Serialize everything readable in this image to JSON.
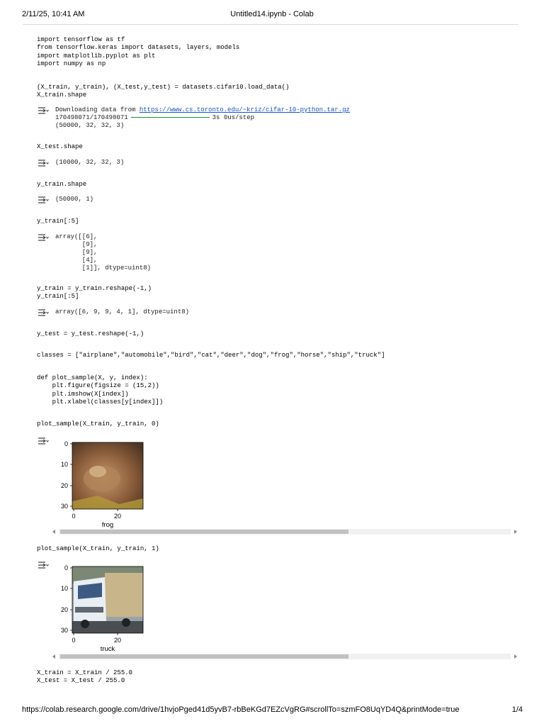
{
  "header": {
    "datetime": "2/11/25, 10:41 AM",
    "title": "Untitled14.ipynb - Colab"
  },
  "footer": {
    "url": "https://colab.research.google.com/drive/1hvjoPged41d5yvB7-rbBeKGd7EZcVgRG#scrollTo=szmFO8UqYD4Q&printMode=true",
    "page": "1/4"
  },
  "cells": {
    "c1": "import tensorflow as tf\nfrom tensorflow.keras import datasets, layers, models\nimport matplotlib.pyplot as plt\nimport numpy as np",
    "c2": "(X_train, y_train), (X_test,y_test) = datasets.cifar10.load_data()\nX_train.shape",
    "c2_out_prefix": "Downloading data from ",
    "c2_out_link": "https://www.cs.toronto.edu/~kriz/cifar-10-python.tar.gz",
    "c2_out_progress": "170498071/170498071",
    "c2_out_timing": "3s 0us/step",
    "c2_out_shape": "(50000, 32, 32, 3)",
    "c3": "X_test.shape",
    "c3_out": "(10000, 32, 32, 3)",
    "c4": "y_train.shape",
    "c4_out": "(50000, 1)",
    "c5": "y_train[:5]",
    "c5_out": "array([[6],\n       [9],\n       [9],\n       [4],\n       [1]], dtype=uint8)",
    "c6": "y_train = y_train.reshape(-1,)\ny_train[:5]",
    "c6_out": "array([6, 9, 9, 4, 1], dtype=uint8)",
    "c7": "y_test = y_test.reshape(-1,)",
    "c8": "classes = [\"airplane\",\"automobile\",\"bird\",\"cat\",\"deer\",\"dog\",\"frog\",\"horse\",\"ship\",\"truck\"]",
    "c9": "def plot_sample(X, y, index):\n    plt.figure(figsize = (15,2))\n    plt.imshow(X[index])\n    plt.xlabel(classes[y[index]])",
    "c10": "plot_sample(X_train, y_train, 0)",
    "c11": "plot_sample(X_train, y_train, 1)",
    "c12": "X_train = X_train / 255.0\nX_test = X_test / 255.0"
  },
  "plots": {
    "frog": {
      "y_ticks": [
        "0",
        "10",
        "20",
        "30"
      ],
      "x_ticks": [
        "0",
        "20"
      ],
      "xlabel": "frog"
    },
    "truck": {
      "y_ticks": [
        "0",
        "10",
        "20",
        "30"
      ],
      "x_ticks": [
        "0",
        "20"
      ],
      "xlabel": "truck"
    }
  },
  "icons": {
    "output": "output-collapse-icon",
    "scroll_left": "scroll-left-arrow-icon",
    "scroll_right": "scroll-right-arrow-icon"
  }
}
